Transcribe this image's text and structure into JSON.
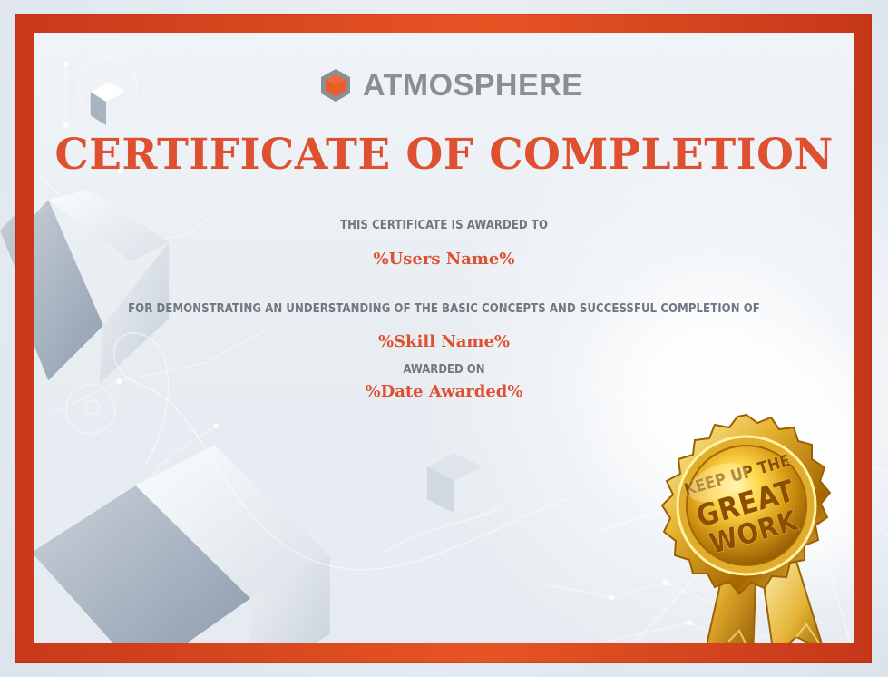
{
  "certificate": {
    "brand": {
      "logo_text": "ATMOSPHERE",
      "logo_icon": "hexagon-logo-icon"
    },
    "title": "CERTIFICATE OF COMPLETION",
    "awarded_to_label": "THIS CERTIFICATE IS AWARDED TO",
    "user_name_placeholder": "%Users Name%",
    "completion_text": "FOR DEMONSTRATING AN UNDERSTANDING OF THE BASIC CONCEPTS AND SUCCESSFUL COMPLETION OF",
    "skill_name_placeholder": "%Skill Name%",
    "awarded_on_label": "AWARDED ON",
    "date_awarded_placeholder": "%Date Awarded%",
    "seal": {
      "icon": "gold-award-seal-icon",
      "line_1": "KEEP UP THE",
      "line_2": "GREAT",
      "line_3": "WORK"
    },
    "colors": {
      "accent": "#df5031",
      "frame": "#e75424",
      "text_gray": "#6f7780",
      "logo_gray": "#8a8f96",
      "logo_orange": "#eb5c2b",
      "gold": "#d9a62b"
    }
  }
}
